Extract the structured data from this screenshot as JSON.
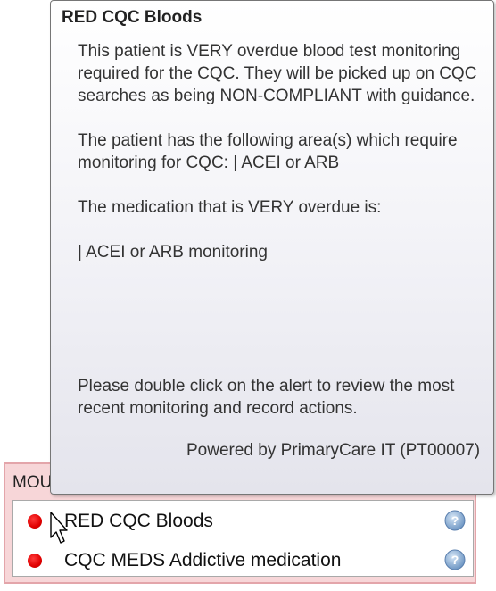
{
  "alerts_panel": {
    "header_text": "MOU",
    "items": [
      {
        "label": "RED CQC Bloods",
        "status_color": "#e00000",
        "icon": "help-icon"
      },
      {
        "label": "CQC MEDS Addictive medication",
        "status_color": "#e00000",
        "icon": "help-icon"
      }
    ]
  },
  "tooltip": {
    "title": "RED CQC Bloods",
    "paragraphs": [
      "This patient is VERY overdue blood test monitoring required for the CQC.  They will be picked up on CQC searches as being NON-COMPLIANT with guidance.",
      "The patient has the following area(s) which require monitoring for CQC: | ACEI or ARB",
      "The medication that is VERY overdue is:",
      "| ACEI or ARB monitoring",
      "Please double click on the alert to review the most recent monitoring and record actions."
    ],
    "footer": "Powered by PrimaryCare IT (PT00007)"
  }
}
